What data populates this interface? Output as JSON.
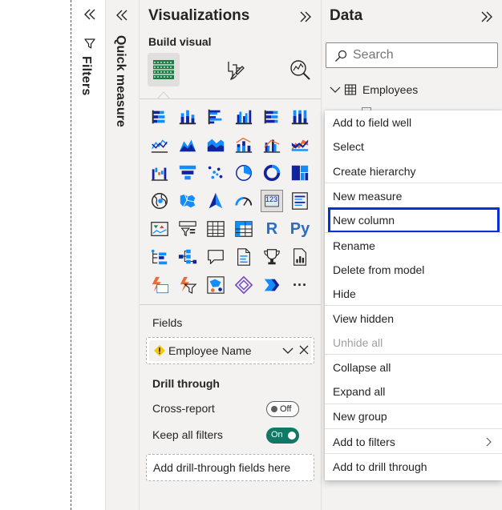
{
  "filters_pane": {
    "label": "Filters",
    "collapse_icon": "double-chevron-left-icon",
    "filter_icon": "funnel-icon"
  },
  "quick_measure_pane": {
    "label": "Quick measure",
    "collapse_icon": "double-chevron-left-icon"
  },
  "visualizations": {
    "title": "Visualizations",
    "expand_icon": "double-chevron-right-icon",
    "build_visual_label": "Build visual",
    "tabs": [
      {
        "name": "build-visual-tab",
        "icon": "table-grid-icon",
        "active": true
      },
      {
        "name": "format-visual-tab",
        "icon": "paintbrush-icon",
        "active": false
      },
      {
        "name": "analytics-tab",
        "icon": "magnifier-chart-icon",
        "active": false
      }
    ],
    "visual_icons": [
      "stacked-bar-chart-icon",
      "stacked-column-chart-icon",
      "clustered-bar-chart-icon",
      "clustered-column-chart-icon",
      "100-stacked-bar-chart-icon",
      "100-stacked-column-chart-icon",
      "line-chart-icon",
      "area-chart-icon",
      "stacked-area-chart-icon",
      "line-and-stacked-column-chart-icon",
      "line-and-clustered-column-chart-icon",
      "ribbon-chart-icon",
      "waterfall-chart-icon",
      "funnel-chart-icon",
      "scatter-chart-icon",
      "pie-chart-icon",
      "donut-chart-icon",
      "treemap-icon",
      "map-icon",
      "filled-map-icon",
      "azure-map-icon",
      "gauge-icon",
      "card-icon",
      "multi-row-card-icon",
      "kpi-icon",
      "slicer-icon",
      "table-icon",
      "matrix-icon",
      "r-visual-icon",
      "python-visual-icon",
      "key-influencers-icon",
      "decomposition-tree-icon",
      "qa-icon",
      "smart-narrative-icon",
      "metrics-icon",
      "paginated-report-icon",
      "power-apps-icon",
      "power-automate-icon",
      "arcgis-icon",
      "powerbi-extra-icon",
      "power-automate-flow-icon",
      "more-visuals-icon"
    ],
    "card_label": "123",
    "r_label": "R",
    "py_label": "Py",
    "more_label": "···",
    "fields_label": "Fields",
    "field_well": {
      "value": "Employee Name",
      "warn_icon": "warning-icon",
      "chevron_icon": "chevron-down-icon",
      "remove_icon": "close-icon"
    },
    "drill_through_label": "Drill through",
    "cross_report": {
      "label": "Cross-report",
      "state": "Off"
    },
    "keep_all_filters": {
      "label": "Keep all filters",
      "state": "On"
    },
    "drill_placeholder": "Add drill-through fields here"
  },
  "data_pane": {
    "title": "Data",
    "expand_icon": "double-chevron-right-icon",
    "search_placeholder": "Search",
    "search_icon": "search-icon",
    "table_name": "Employees",
    "table_icon": "table-icon"
  },
  "context_menu": {
    "items": [
      {
        "label": "Add to field well",
        "enabled": true
      },
      {
        "label": "Select",
        "enabled": true
      },
      {
        "label": "Create hierarchy",
        "enabled": true
      },
      {
        "label": "New measure",
        "enabled": true
      },
      {
        "label": "New column",
        "enabled": true,
        "highlighted": true
      },
      {
        "label": "Rename",
        "enabled": true
      },
      {
        "label": "Delete from model",
        "enabled": true
      },
      {
        "label": "Hide",
        "enabled": true
      },
      {
        "label": "View hidden",
        "enabled": true
      },
      {
        "label": "Unhide all",
        "enabled": false
      },
      {
        "label": "Collapse all",
        "enabled": true
      },
      {
        "label": "Expand all",
        "enabled": true
      },
      {
        "label": "New group",
        "enabled": true
      },
      {
        "label": "Add to filters",
        "enabled": true,
        "submenu": true
      },
      {
        "label": "Add to drill through",
        "enabled": true
      }
    ]
  },
  "colors": {
    "pane_bg": "#f3f2f1",
    "accent_teal": "#117865",
    "highlight_blue": "#0a2fd7",
    "visual_blue": "#118dff",
    "visual_dark": "#12239e",
    "visual_orange": "#e66c37"
  }
}
